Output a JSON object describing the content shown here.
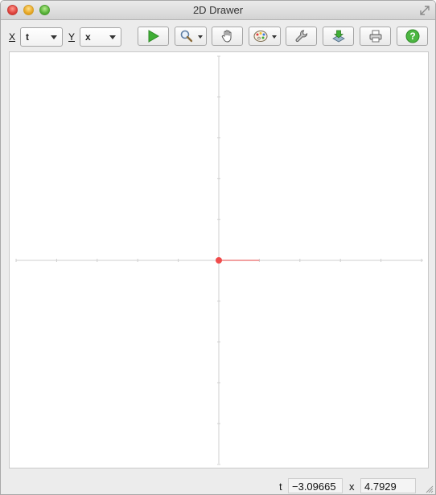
{
  "window": {
    "title": "2D Drawer"
  },
  "toolbar": {
    "x_axis_label": "X",
    "x_axis_value": "t",
    "y_axis_label": "Y",
    "y_axis_value": "x"
  },
  "icons": {
    "run": "play-icon",
    "zoom": "magnifier-icon",
    "pan": "hand-icon",
    "palette": "palette-icon",
    "settings": "wrench-icon",
    "export": "download-icon",
    "print": "printer-icon",
    "help": "help-icon"
  },
  "colors": {
    "accent_green": "#3fae35",
    "point_red": "#f04b4b",
    "axis_gray": "#cfcfcf"
  },
  "plot": {
    "x_range": [
      -5,
      5
    ],
    "y_range": [
      -5,
      5
    ],
    "origin_point": {
      "x": 0,
      "y": 0
    },
    "segment": {
      "x_start": 0,
      "x_end": 1,
      "y": 0
    }
  },
  "status": {
    "x_label": "t",
    "x_value": "−3.09665",
    "y_label": "x",
    "y_value": "4.7929"
  }
}
